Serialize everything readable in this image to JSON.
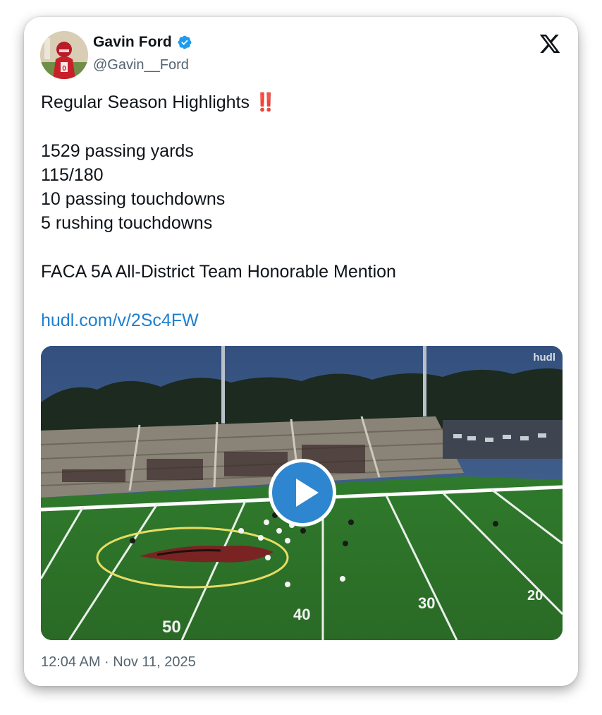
{
  "author": {
    "display_name": "Gavin Ford",
    "handle": "@Gavin__Ford",
    "verified": true,
    "avatar_icon": "avatar-photo-icon"
  },
  "header": {
    "logo_icon": "x-logo-icon"
  },
  "post": {
    "title_line": "Regular Season Highlights",
    "title_emoji": "‼️",
    "stats": [
      "1529 passing yards",
      "115/180",
      "10 passing touchdowns",
      "5 rushing touchdowns"
    ],
    "honor": "FACA 5A All-District Team Honorable Mention",
    "link": "hudl.com/v/2Sc4FW"
  },
  "media": {
    "type": "video",
    "watermark": "hudl",
    "play_icon": "play-icon"
  },
  "timestamp": "12:04 AM · Nov 11, 2025",
  "colors": {
    "link": "#1d7fd0",
    "verified": "#1d9bf0",
    "play_button": "#2e86d0",
    "muted_text": "#536471"
  }
}
